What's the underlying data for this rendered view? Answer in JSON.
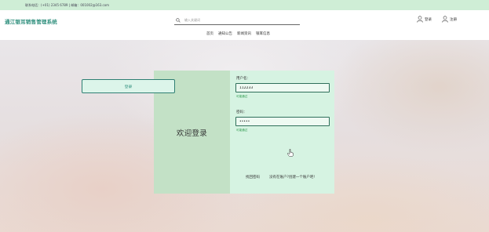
{
  "topbar": {
    "contact_text": "联系电话：(+01) 2345 6789 | 邮箱：001002@163.com"
  },
  "header": {
    "site_title": "通江银耳销售管理系统",
    "search": {
      "placeholder": "输入关键词"
    },
    "user_links": {
      "login": "登录",
      "register": "注册"
    },
    "nav": [
      {
        "label": "首页"
      },
      {
        "label": "通知公告"
      },
      {
        "label": "新闻资讯"
      },
      {
        "label": "银耳信息"
      }
    ]
  },
  "login_card": {
    "welcome": "欢迎登录",
    "username": {
      "label": "用户名：",
      "value": "112233",
      "hint": "可能通过"
    },
    "password": {
      "label": "密码：",
      "value": "•••••",
      "hint": "可能通过"
    },
    "login_button": "登录",
    "forgot_password": "找回密码",
    "create_account": "没有在账户?创建一个账户吧!"
  },
  "colors": {
    "accent": "#2f8f7d",
    "topbar_bg": "#cfeed6",
    "card_left_bg": "#c3e1c6",
    "card_right_bg": "#d6f3e2",
    "hint_green": "#2f9b4f"
  },
  "icons": {
    "search": "search-icon",
    "user": "user-icon",
    "cursor": "hand-pointer-icon"
  }
}
